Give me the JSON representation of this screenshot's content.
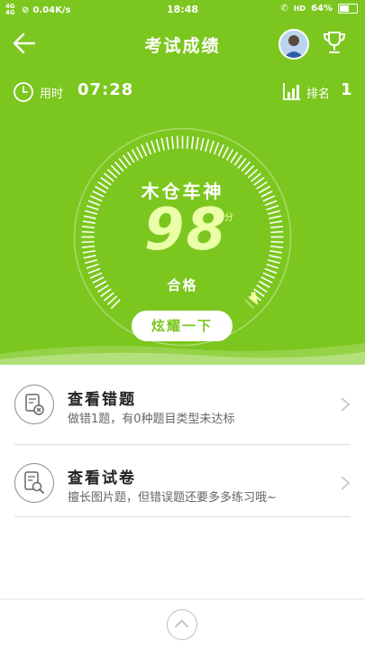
{
  "status_bar": {
    "network": "4G 4G",
    "speed": "0.04K/s",
    "time": "18:48",
    "network_right": "HD",
    "battery_percent": "64%",
    "battery_level": 0.64
  },
  "nav": {
    "title": "考试成绩",
    "icons": [
      "back-arrow-icon",
      "avatar",
      "trophy-icon"
    ]
  },
  "info": {
    "time_label": "用时",
    "time_value": "07:28",
    "rank_label": "排名",
    "rank_value": "1"
  },
  "result": {
    "user_name": "木仓车神",
    "score": "98",
    "score_unit": "分",
    "status": "合格",
    "score_fraction": 0.98
  },
  "actions": {
    "show_off_label": "炫耀一下"
  },
  "list": [
    {
      "title": "查看错题",
      "subtitle": "做错1题，有0种题目类型未达标",
      "icon": "wrong-questions-icon"
    },
    {
      "title": "查看试卷",
      "subtitle": "擅长图片题，但错误题还要多多练习哦~",
      "icon": "view-paper-icon"
    }
  ],
  "colors": {
    "primary_green": "#7cc71f",
    "score_color": "#eaffa8"
  }
}
